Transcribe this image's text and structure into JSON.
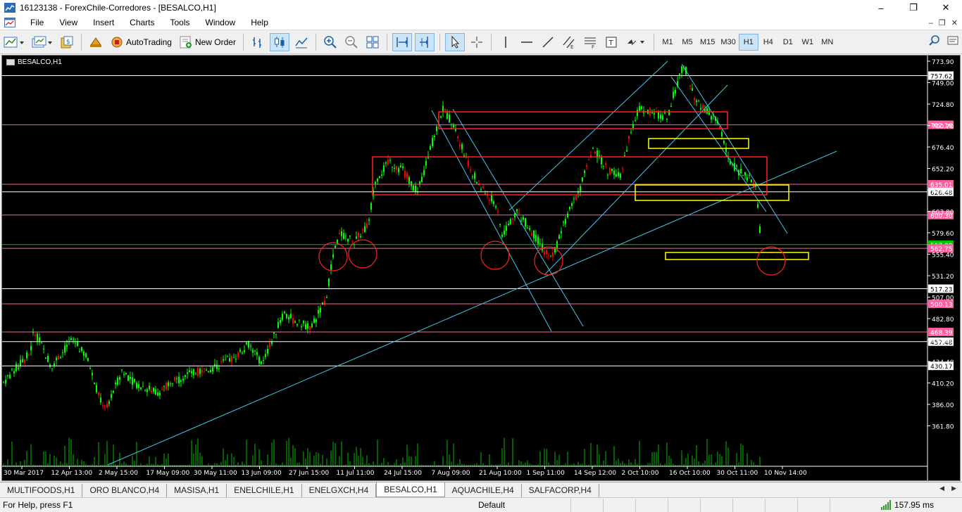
{
  "window": {
    "title": "16123138 - ForexChile-Corredores - [BESALCO,H1]"
  },
  "window_buttons": [
    "–",
    "❐",
    "✕"
  ],
  "menu": [
    "File",
    "View",
    "Insert",
    "Charts",
    "Tools",
    "Window",
    "Help"
  ],
  "mdi_buttons": [
    "–",
    "❐",
    "✕"
  ],
  "toolbar": {
    "autotrading_label": "AutoTrading",
    "new_order_label": "New Order"
  },
  "timeframes": [
    "M1",
    "M5",
    "M15",
    "M30",
    "H1",
    "H4",
    "D1",
    "W1",
    "MN"
  ],
  "active_timeframe": "H1",
  "chart": {
    "title": "BESALCO,H1",
    "background": "#000000",
    "candle_color": "#00ff00",
    "bear_color": "#ff0000",
    "price_ticks": [
      "773.90",
      "749.00",
      "724.80",
      "700.70",
      "676.40",
      "652.20",
      "628.00",
      "603.80",
      "579.60",
      "555.40",
      "531.20",
      "507.00",
      "482.80",
      "458.60",
      "434.40",
      "410.20",
      "386.00",
      "361.80"
    ],
    "time_labels": [
      "30 Mar 2017",
      "12 Apr 13:00",
      "2 May 15:00",
      "17 May 09:00",
      "30 May 11:00",
      "13 Jun 09:00",
      "27 Jun 15:00",
      "11 Jul 11:00",
      "24 Jul 15:00",
      "7 Aug 09:00",
      "21 Aug 10:00",
      "1 Sep 11:00",
      "14 Sep 12:00",
      "2 Oct 10:00",
      "16 Oct 10:00",
      "30 Oct 11:00",
      "10 Nov 14:00"
    ],
    "horizontal_levels": [
      {
        "price": 757.62,
        "label": "757.62",
        "color": "#ffffff"
      },
      {
        "price": 702.16,
        "label": "702.16",
        "color": "#ff5fa0"
      },
      {
        "price": 635.01,
        "label": "635.01",
        "color": "#ff5fa0"
      },
      {
        "price": 626.48,
        "label": "626.48",
        "color": "#ffffff"
      },
      {
        "price": 600.3,
        "label": "600.30",
        "color": "#ff5fa0"
      },
      {
        "price": 567.0,
        "label": "567.00",
        "color": "#00c000"
      },
      {
        "price": 562.75,
        "label": "562.75",
        "color": "#ff5fa0"
      },
      {
        "price": 517.23,
        "label": "517.23",
        "color": "#ffffff"
      },
      {
        "price": 500.13,
        "label": "500.13",
        "color": "#ff5fa0"
      },
      {
        "price": 468.39,
        "label": "468.39",
        "color": "#ff5fa0"
      },
      {
        "price": 457.48,
        "label": "457.48",
        "color": "#ffffff"
      },
      {
        "price": 430.17,
        "label": "430.17",
        "color": "#ffffff"
      }
    ]
  },
  "tabs": [
    "MULTIFOODS,H1",
    "ORO BLANCO,H4",
    "MASISA,H1",
    "ENELCHILE,H1",
    "ENELGXCH,H4",
    "BESALCO,H1",
    "AQUACHILE,H4",
    "SALFACORP,H4"
  ],
  "active_tab": "BESALCO,H1",
  "tab_arrows": [
    "◀",
    "▶"
  ],
  "status": {
    "help": "For Help, press F1",
    "profile": "Default",
    "connection": "157.95 ms"
  }
}
